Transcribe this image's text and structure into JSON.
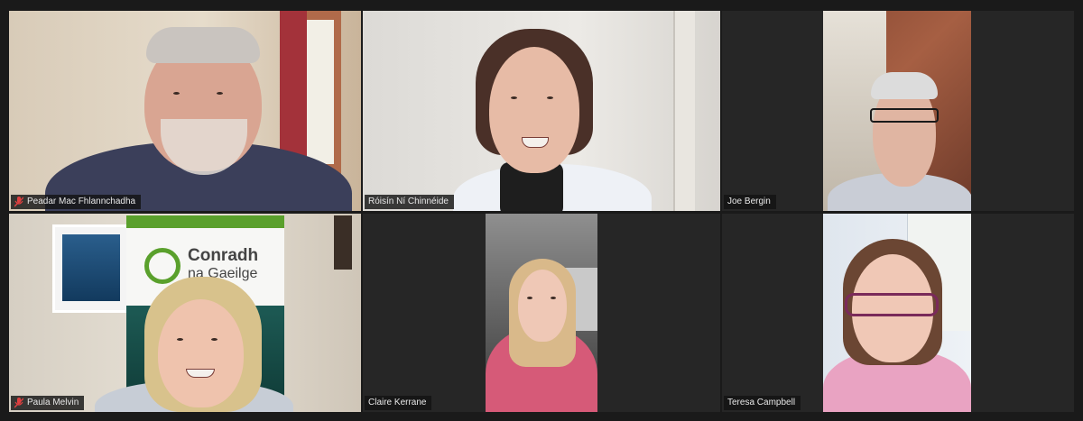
{
  "participants": [
    {
      "name": "Peadar Mac Fhlannchadha",
      "muted": true
    },
    {
      "name": "Róisín Ní Chinnéide",
      "muted": false,
      "active_speaker": true
    },
    {
      "name": "Joe Bergin",
      "muted": false
    },
    {
      "name": "Paula Melvin",
      "muted": true
    },
    {
      "name": "Claire Kerrane",
      "muted": false
    },
    {
      "name": "Teresa Campbell",
      "muted": false
    }
  ],
  "banner": {
    "title_line1": "Conradh",
    "title_line2": "na Gaeilge"
  },
  "colors": {
    "active_border": "#b8db3f",
    "mute_icon": "#e04040",
    "banner_green": "#5aa02c"
  }
}
